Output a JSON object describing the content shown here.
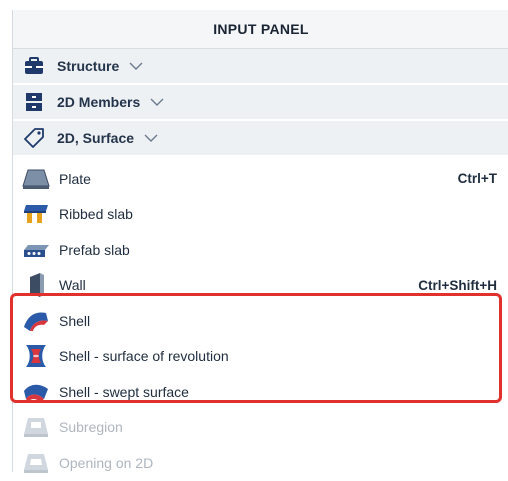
{
  "panel": {
    "title": "INPUT PANEL"
  },
  "groups": [
    {
      "label": "Structure",
      "icon": "toolbox-icon"
    },
    {
      "label": "2D Members",
      "icon": "2d-members-icon"
    },
    {
      "label": "2D, Surface",
      "icon": "tag-icon"
    }
  ],
  "items": [
    {
      "label": "Plate",
      "shortcut": "Ctrl+T",
      "icon": "plate-icon",
      "enabled": true
    },
    {
      "label": "Ribbed slab",
      "shortcut": "",
      "icon": "ribbed-slab-icon",
      "enabled": true
    },
    {
      "label": "Prefab slab",
      "shortcut": "",
      "icon": "prefab-slab-icon",
      "enabled": true
    },
    {
      "label": "Wall",
      "shortcut": "Ctrl+Shift+H",
      "icon": "wall-icon",
      "enabled": true
    },
    {
      "label": "Shell",
      "shortcut": "",
      "icon": "shell-icon",
      "enabled": true
    },
    {
      "label": "Shell - surface of revolution",
      "shortcut": "",
      "icon": "shell-revolution-icon",
      "enabled": true
    },
    {
      "label": "Shell - swept surface",
      "shortcut": "",
      "icon": "shell-swept-icon",
      "enabled": true
    },
    {
      "label": "Subregion",
      "shortcut": "",
      "icon": "subregion-icon",
      "enabled": false
    },
    {
      "label": "Opening on 2D",
      "shortcut": "",
      "icon": "opening-icon",
      "enabled": false
    }
  ],
  "colors": {
    "highlight": "#e0312c",
    "accent_blue": "#2a5aa8",
    "header_bg": "#f4f6f8",
    "group_bg": "#eef1f4"
  }
}
